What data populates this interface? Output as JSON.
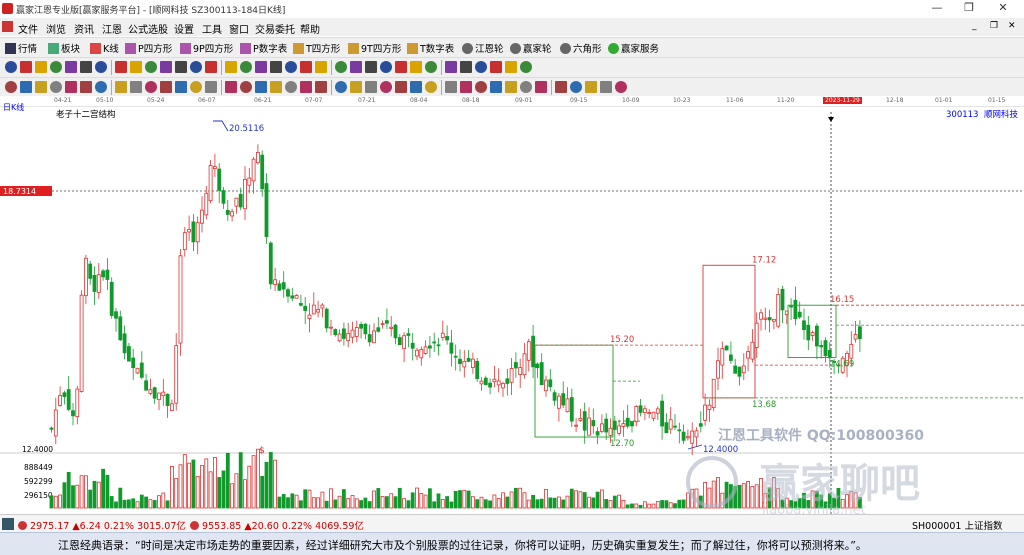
{
  "window": {
    "title": "赢家江恩专业版[赢家服务平台] - [顺网科技  SZ300113-184日K线]",
    "min": "—",
    "max": "❐",
    "close": "✕"
  },
  "menu": [
    "文件",
    "浏览",
    "资讯",
    "江恩",
    "公式选股",
    "设置",
    "工具",
    "窗口",
    "交易委托",
    "帮助"
  ],
  "toolbar1": [
    {
      "label": "行情",
      "icon": "grid-icon"
    },
    {
      "label": "板块",
      "icon": "blocks-icon"
    },
    {
      "label": "K线",
      "icon": "kline-icon"
    },
    {
      "label": "P四方形",
      "icon": "p-square-icon"
    },
    {
      "label": "9P四方形",
      "icon": "9p-square-icon"
    },
    {
      "label": "P数字表",
      "icon": "p-table-icon"
    },
    {
      "label": "T四方形",
      "icon": "t-square-icon"
    },
    {
      "label": "9T四方形",
      "icon": "9t-square-icon"
    },
    {
      "label": "T数字表",
      "icon": "t-table-icon"
    },
    {
      "label": "江恩轮",
      "icon": "gann-wheel-icon"
    },
    {
      "label": "赢家轮",
      "icon": "winner-wheel-icon"
    },
    {
      "label": "六角形",
      "icon": "hexagon-icon"
    },
    {
      "label": "赢家服务",
      "icon": "dollar-icon"
    }
  ],
  "mdi_controls": [
    "_",
    "❐",
    "✕"
  ],
  "chart": {
    "period_label": "日K线",
    "indicator_name": "老子十二宫结构",
    "symbol_code": "300113",
    "symbol_name": "顺网科技",
    "crosshair_date": "2023-11-29",
    "crosshair_price": "18.7314",
    "price_labels": {
      "high": "20.5116",
      "low": "12.4000"
    },
    "box_labels": [
      "15.20",
      "12.70",
      "17.12",
      "13.68",
      "16.15",
      "14.69"
    ],
    "date_ticks": [
      "04-21",
      "05-10",
      "05-24",
      "06-07",
      "06-21",
      "07-07",
      "07-21",
      "08-04",
      "08-18",
      "09-01",
      "09-15",
      "10-09",
      "10-23",
      "11-06",
      "11-20",
      "2023-11-29",
      "12-18",
      "01-01",
      "01-15"
    ],
    "volume_axis": [
      "888449",
      "592299",
      "296150"
    ],
    "dollar_marker": "$"
  },
  "watermark": {
    "line1": "江恩工具软件  QQ:100800360",
    "line2": "赢家聊吧",
    "line3": "liaoba.yinjia.net"
  },
  "status_bar": {
    "sh_index": "2975.17",
    "sh_change": "▲6.24",
    "sh_pct": "0.21%",
    "sh_amount": "3015.07亿",
    "sz_index": "9553.85",
    "sz_change": "▲20.60",
    "sz_pct": "0.22%",
    "sz_amount": "4069.59亿",
    "right_label": "SH000001 上证指数"
  },
  "quote_bar": "江恩经典语录：“时间是决定市场走势的重要因素，经过详细研究大市及个别股票的过往记录，你将可以证明，历史确实重复发生；而了解过往，你将可以预测将来。”。",
  "colors": {
    "up": "#e0302f",
    "down": "#109a2c",
    "box_red": "#dd3333",
    "box_green": "#2a9a2a"
  }
}
